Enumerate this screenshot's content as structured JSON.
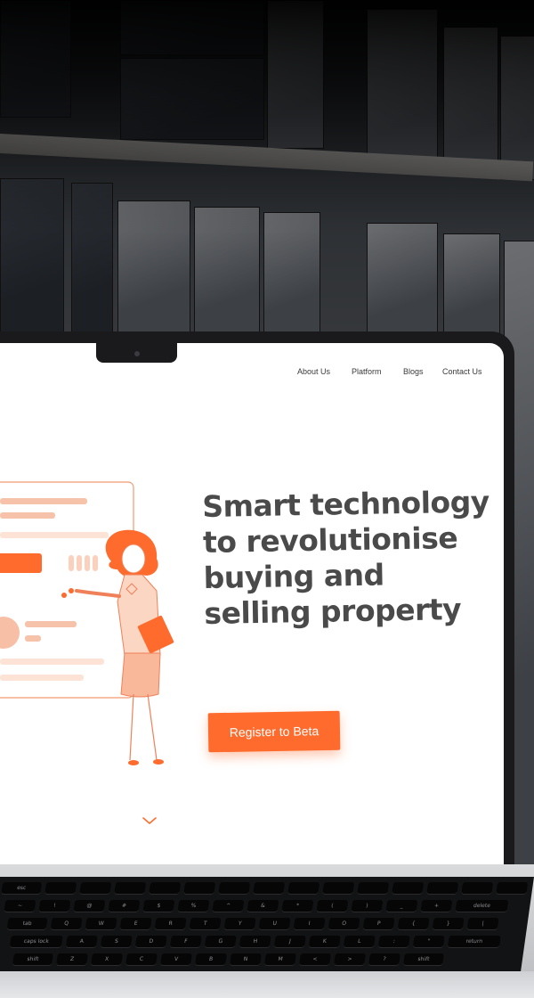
{
  "nav": {
    "items": [
      "About Us",
      "Platform",
      "Blogs",
      "Contact Us"
    ]
  },
  "hero": {
    "title": "Smart technology to revolutionise buying and selling property",
    "cta_label": "Register to Beta"
  },
  "colors": {
    "accent": "#ff6b2c",
    "accent_light": "#f9c4ab",
    "text_dark": "#4a4a4a"
  },
  "icons": {
    "scroll": "chevron-down-icon",
    "camera": "camera-icon"
  },
  "keyboard": {
    "row1": [
      "esc",
      "",
      "",
      "",
      "",
      "",
      "",
      "",
      "",
      "",
      "",
      "",
      "",
      "",
      ""
    ],
    "row2": [
      "~",
      "!",
      "@",
      "#",
      "$",
      "%",
      "^",
      "&",
      "*",
      "(",
      ")",
      "_",
      "+",
      "delete"
    ],
    "row3": [
      "tab",
      "Q",
      "W",
      "E",
      "R",
      "T",
      "Y",
      "U",
      "I",
      "O",
      "P",
      "{",
      "}",
      "|"
    ],
    "row4": [
      "caps lock",
      "A",
      "S",
      "D",
      "F",
      "G",
      "H",
      "J",
      "K",
      "L",
      ":",
      "\"",
      "return"
    ],
    "row5": [
      "shift",
      "Z",
      "X",
      "C",
      "V",
      "B",
      "N",
      "M",
      "<",
      ">",
      "?",
      "shift"
    ]
  }
}
